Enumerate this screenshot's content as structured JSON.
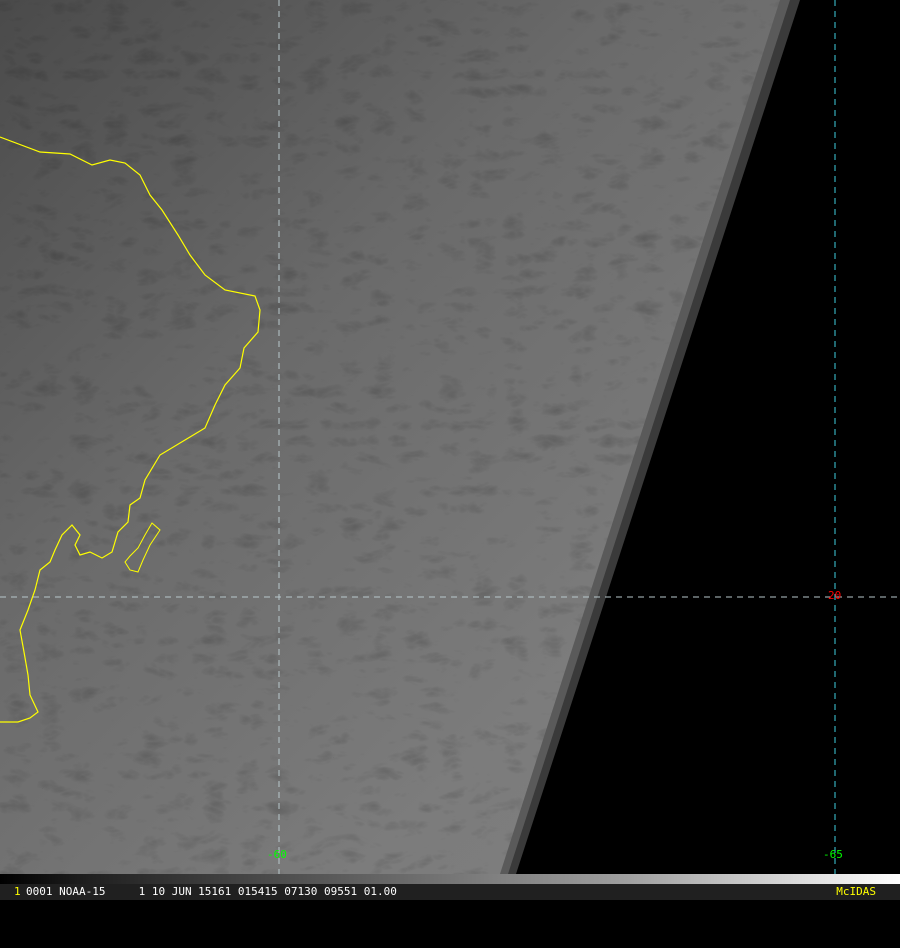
{
  "image": {
    "satellite_info": "0001 NOAA-15     1 10 JUN 15161 015415 07130 09551 01.00",
    "frame_number": "1",
    "software": "McIDAS"
  },
  "grid_labels": {
    "lon_left": "-60",
    "lon_right": "-65",
    "lat": "20"
  },
  "colors": {
    "grid": "#a8d8e0",
    "coastline": "#ffff00",
    "lon_label": "#00ff00",
    "lat_label": "#ff0000"
  }
}
